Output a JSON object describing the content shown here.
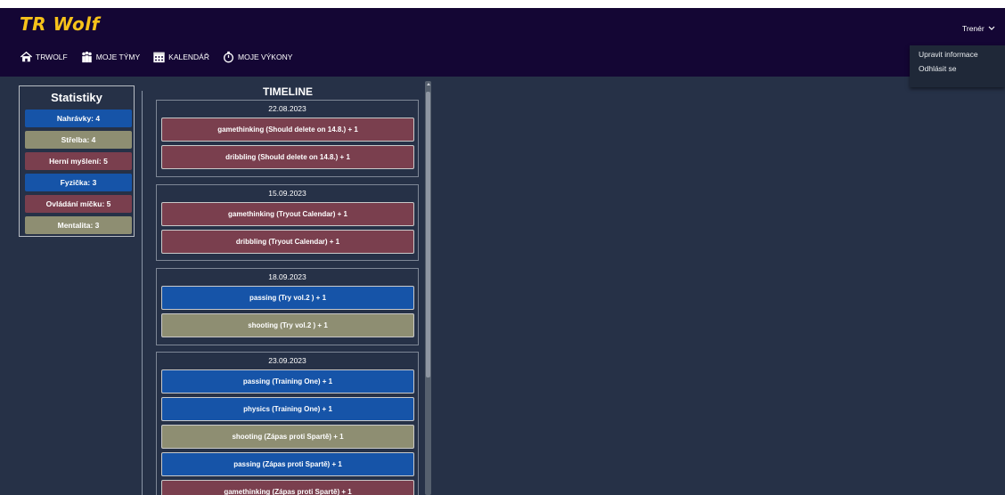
{
  "brand": "TR Wolf",
  "nav": [
    {
      "label": "TRWOLF",
      "icon": "home-icon"
    },
    {
      "label": "MOJE TÝMY",
      "icon": "team-icon"
    },
    {
      "label": "KALENDÁŘ",
      "icon": "calendar-icon"
    },
    {
      "label": "MOJE VÝKONY",
      "icon": "stopwatch-icon"
    }
  ],
  "user_menu": {
    "label": "Trenér",
    "items": [
      "Upravit informace",
      "Odhlásit se"
    ]
  },
  "stats": {
    "title": "Statistiky",
    "items": [
      {
        "label": "Nahrávky: 4",
        "color": "#1654a8"
      },
      {
        "label": "Střelba: 4",
        "color": "#8e8e72"
      },
      {
        "label": "Herní myšlení: 5",
        "color": "#7a3f4e"
      },
      {
        "label": "Fyzička: 3",
        "color": "#1654a8"
      },
      {
        "label": "Ovládání míčku: 5",
        "color": "#7a3f4e"
      },
      {
        "label": "Mentalita: 3",
        "color": "#8e8e72"
      }
    ]
  },
  "timeline": {
    "title": "TIMELINE",
    "days": [
      {
        "date": "22.08.2023",
        "entries": [
          {
            "label": "gamethinking (Should delete on 14.8.) + 1",
            "color": "#7a3f4e"
          },
          {
            "label": "dribbling (Should delete on 14.8.) + 1",
            "color": "#7a3f4e"
          }
        ]
      },
      {
        "date": "15.09.2023",
        "entries": [
          {
            "label": "gamethinking (Tryout Calendar) + 1",
            "color": "#7a3f4e"
          },
          {
            "label": "dribbling (Tryout Calendar) + 1",
            "color": "#7a3f4e"
          }
        ]
      },
      {
        "date": "18.09.2023",
        "entries": [
          {
            "label": "passing (Try vol.2 ) + 1",
            "color": "#1654a8"
          },
          {
            "label": "shooting (Try vol.2 ) + 1",
            "color": "#8e8e72"
          }
        ]
      },
      {
        "date": "23.09.2023",
        "entries": [
          {
            "label": "passing (Training One) + 1",
            "color": "#1654a8"
          },
          {
            "label": "physics (Training One) + 1",
            "color": "#1654a8"
          },
          {
            "label": "shooting (Zápas proti Spartě) + 1",
            "color": "#8e8e72"
          },
          {
            "label": "passing (Zápas proti Spartě) + 1",
            "color": "#1654a8"
          },
          {
            "label": "gamethinking (Zápas proti Spartě) + 1",
            "color": "#7a3f4e"
          }
        ]
      }
    ]
  }
}
